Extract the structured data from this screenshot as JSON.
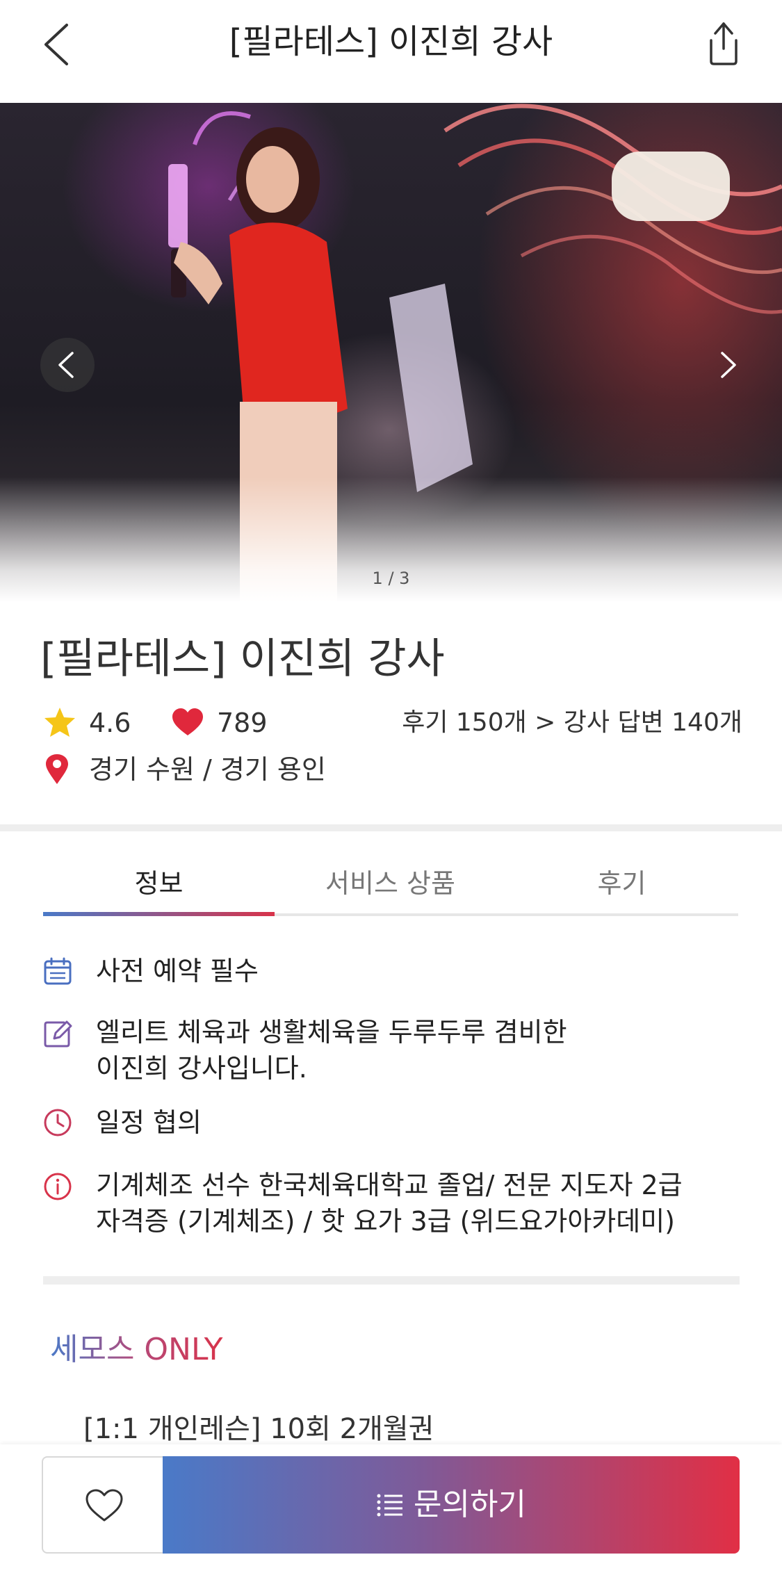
{
  "header": {
    "title": "[필라테스] 이진희 강사",
    "back_icon": "chevron-left-icon",
    "share_icon": "share-icon"
  },
  "hero": {
    "counter": "1 / 3",
    "current_slide": 1,
    "total_slides": 3,
    "prev_icon": "chevron-left-icon",
    "next_icon": "chevron-right-icon"
  },
  "instructor": {
    "title": "[필라테스] 이진희 강사",
    "rating": "4.6",
    "likes": "789",
    "reviews": "후기 150개  > 강사 답변 140개",
    "location": "경기 수원 / 경기 용인"
  },
  "tabs": [
    {
      "label": "정보",
      "active": true
    },
    {
      "label": "서비스 상품",
      "active": false
    },
    {
      "label": "후기",
      "active": false
    }
  ],
  "info": [
    {
      "icon": "calendar-icon",
      "lines": [
        "사전 예약 필수"
      ]
    },
    {
      "icon": "edit-icon",
      "lines": [
        "엘리트 체육과 생활체육을 두루두루 겸비한",
        "이진희 강사입니다."
      ]
    },
    {
      "icon": "clock-icon",
      "lines": [
        "일정 협의"
      ]
    },
    {
      "icon": "info-icon",
      "lines": [
        "기계체조 선수 한국체육대학교 졸업/ 전문 지도자 2급",
        "자격증 (기계체조) / 핫 요가 3급 (위드요가아카데미)"
      ]
    }
  ],
  "semos": {
    "title": "세모스 ONLY",
    "product": "[1:1 개인레슨] 10회 2개월권"
  },
  "bottom": {
    "inquire_label": "문의하기",
    "favorite_icon": "heart-outline-icon"
  },
  "colors": {
    "accent_blue": "#4a7ac8",
    "accent_red": "#d8334a",
    "star": "#f5c518",
    "heart": "#e0283c"
  }
}
